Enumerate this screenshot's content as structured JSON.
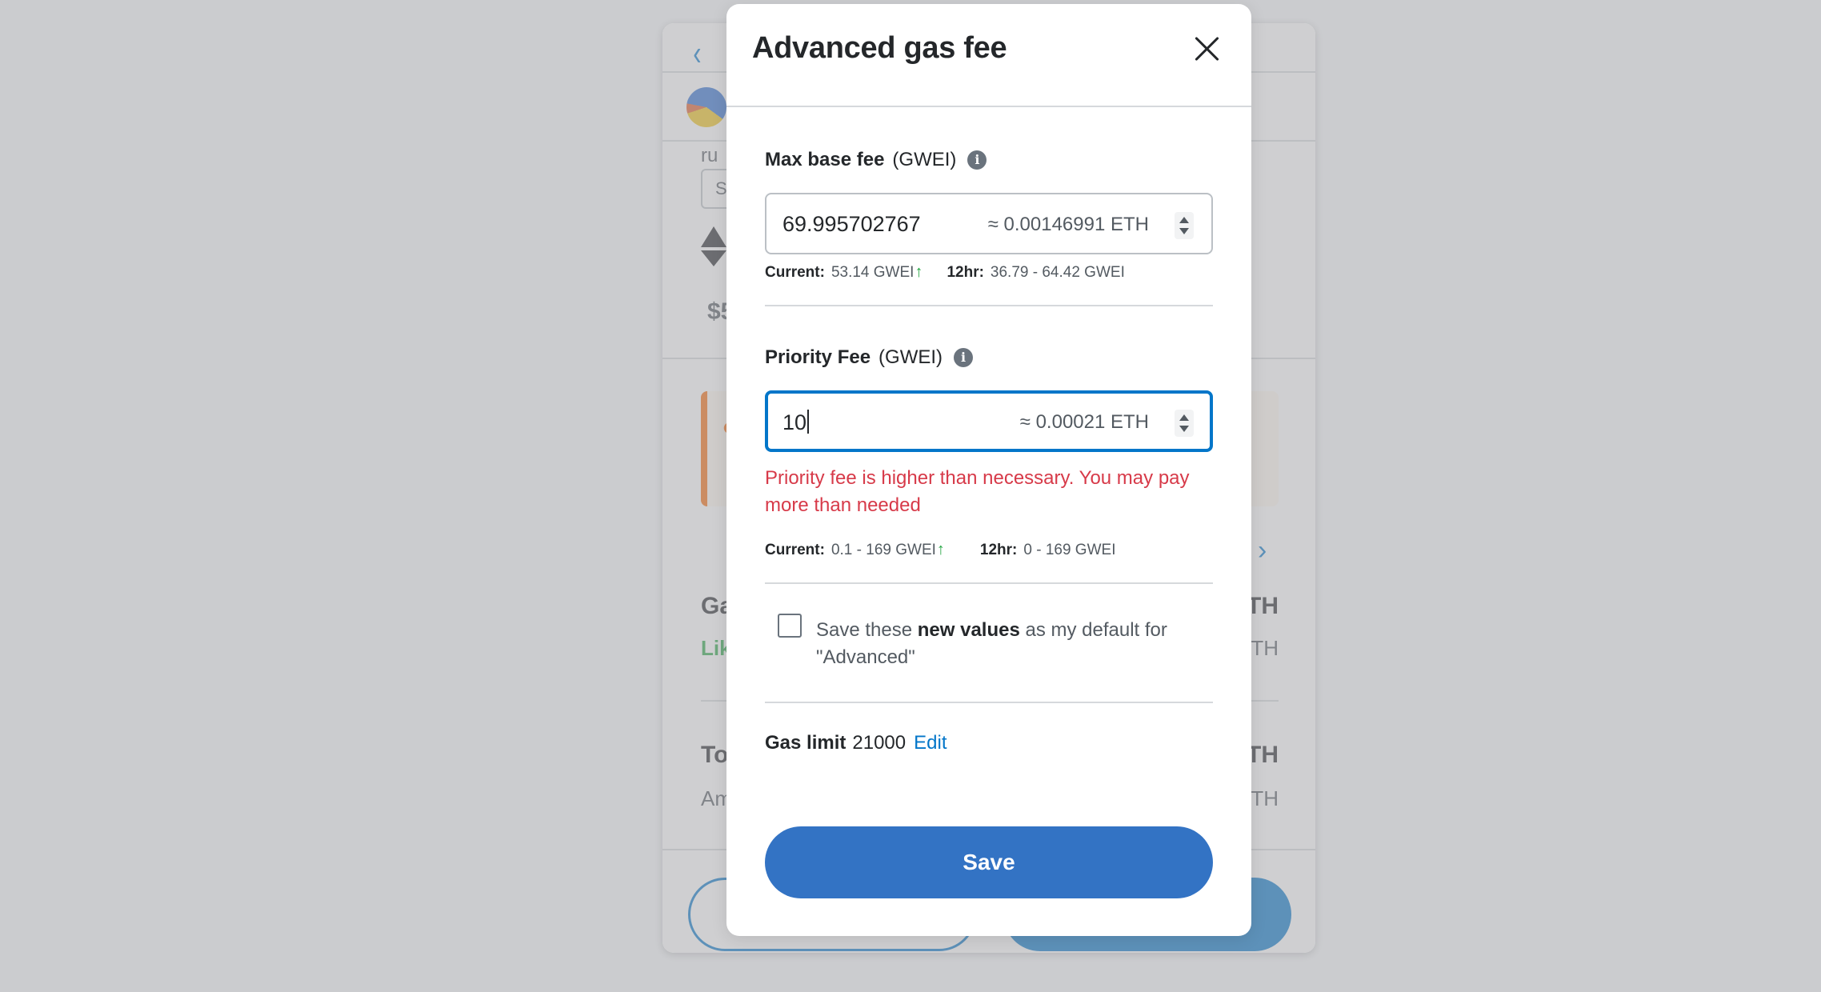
{
  "background": {
    "gas_label": "Ga",
    "likely_label": "Lik",
    "gas_value_fragment": "TH",
    "gas_sub_fragment": "TH",
    "total_label": "To",
    "total_value_fragment": "TH",
    "amount_label": "Am",
    "amount_value_fragment": "TH",
    "fiat_fragment": "$5",
    "small_box_text": "S",
    "row_label": "ru"
  },
  "modal": {
    "title": "Advanced gas fee",
    "max_base_fee": {
      "label": "Max base fee",
      "unit": "(GWEI)",
      "value": "69.995702767",
      "secondary": "≈ 0.00146991 ETH",
      "current_key": "Current:",
      "current_value": "53.14 GWEI",
      "range_key": "12hr:",
      "range_value": "36.79 - 64.42 GWEI"
    },
    "priority_fee": {
      "label": "Priority Fee",
      "unit": "(GWEI)",
      "value": "10",
      "secondary": "≈ 0.00021 ETH",
      "error": "Priority fee is higher than necessary. You may pay more than needed",
      "current_key": "Current:",
      "current_value": "0.1 - 169 GWEI",
      "range_key": "12hr:",
      "range_value": "0 - 169 GWEI"
    },
    "save_default": {
      "checked": false,
      "text_before": "Save these ",
      "text_bold": "new values",
      "text_after": " as my default for \"Advanced\""
    },
    "gas_limit": {
      "label": "Gas limit",
      "value": "21000",
      "edit_label": "Edit"
    },
    "save_label": "Save"
  },
  "colors": {
    "accent": "#0376c9",
    "save_button": "#3373c4",
    "error": "#d73a49",
    "success_arrow": "#28a745",
    "warning": "#f66a0a"
  },
  "icons": [
    "close-icon",
    "info-icon",
    "arrow-up-icon",
    "stepper-icon",
    "chevron-left-icon",
    "chevron-right-icon",
    "ethereum-icon"
  ]
}
